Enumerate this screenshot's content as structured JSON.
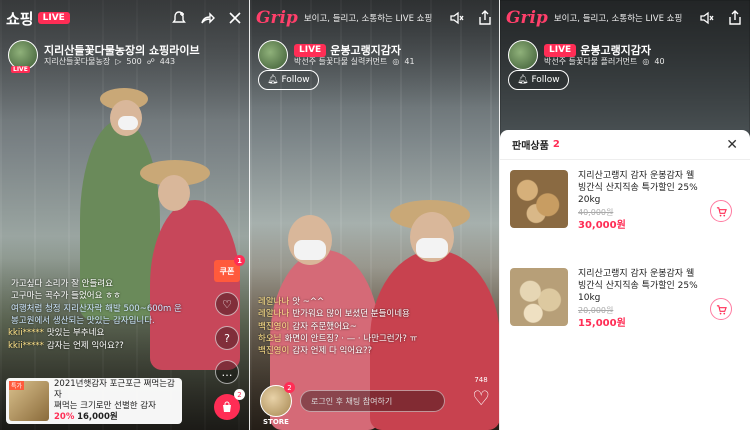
{
  "panel1": {
    "brand": "쇼핑",
    "live": "LIVE",
    "host_title": "지리산들꽃다물농장의 쇼핑라이브",
    "host_name": "지리산들꽃다물농장",
    "likes": "500",
    "viewers": "443",
    "avatar_live": "LIVE",
    "chat": [
      {
        "who": "",
        "text": "가고싶다 소리가 잘 안들려요"
      },
      {
        "who": "",
        "text": "고구마는 곡수가 들었어요 ㅎㅎ"
      },
      {
        "who": "",
        "text": "여행처럼 청정 지리산자락 해발 500~600m 운"
      },
      {
        "who": "",
        "text": "봉고원에서 생산되는 맛있는 감자입니다."
      },
      {
        "who": "kkii*****",
        "text": "맛있는 부추네요"
      },
      {
        "who": "kkii*****",
        "text": "감자는 언제 익어요??"
      }
    ],
    "coupon": "쿠폰",
    "coupon_badge": "1",
    "cart_badge": "2",
    "product": {
      "tag": "특가",
      "name_line1": "2021년햇감자 포근포근 쪄먹는감자",
      "name_line2": "쪄먹는 크기로만 선별한 감자",
      "discount": "20%",
      "price": "16,000원"
    }
  },
  "panel2": {
    "logo": "Grip",
    "tagline": "보이고, 들리고, 소통하는 LIVE 쇼핑",
    "live": "LIVE",
    "host_title": "운봉고랭지감자",
    "host_sub": "박선주 들꽃다물 실력커먼트",
    "viewers": "41",
    "follow": "Follow",
    "chat": [
      {
        "who": "레알나나",
        "text": "앗 ~^^"
      },
      {
        "who": "레알나나",
        "text": "반가워요 많이 보셨던 분들이네용"
      },
      {
        "who": "백진영이",
        "text": "감자 주문했어요~"
      },
      {
        "who": "하오님",
        "text": "화면이 안트징? · — · 나만그런가? ㅠ"
      },
      {
        "who": "백진영이",
        "text": "감자 언제 다 익어요??"
      }
    ],
    "store_badge": "2",
    "store_label": "STORE",
    "input_placeholder": "로그인 후 채팅 참여하기",
    "heart_count": "748"
  },
  "panel3": {
    "logo": "Grip",
    "tagline": "보이고, 들리고, 소통하는 LIVE 쇼핑",
    "live": "LIVE",
    "host_title": "운봉고랭지감자",
    "host_sub": "박선주 들꽃다물 플러거먼트",
    "viewers": "40",
    "follow": "Follow",
    "sheet_title": "판매상품",
    "sheet_count": "2",
    "items": [
      {
        "title": "지리산고랭지 감자 운봉감자 웰빙간식 산지직송 특가할인 25% 20kg",
        "original": "40,000원",
        "sale": "30,000원"
      },
      {
        "title": "지리산고랭지 감자 운봉감자 웰빙간식 산지직송 특가할인 25% 10kg",
        "original": "20,000원",
        "sale": "15,000원"
      }
    ]
  }
}
